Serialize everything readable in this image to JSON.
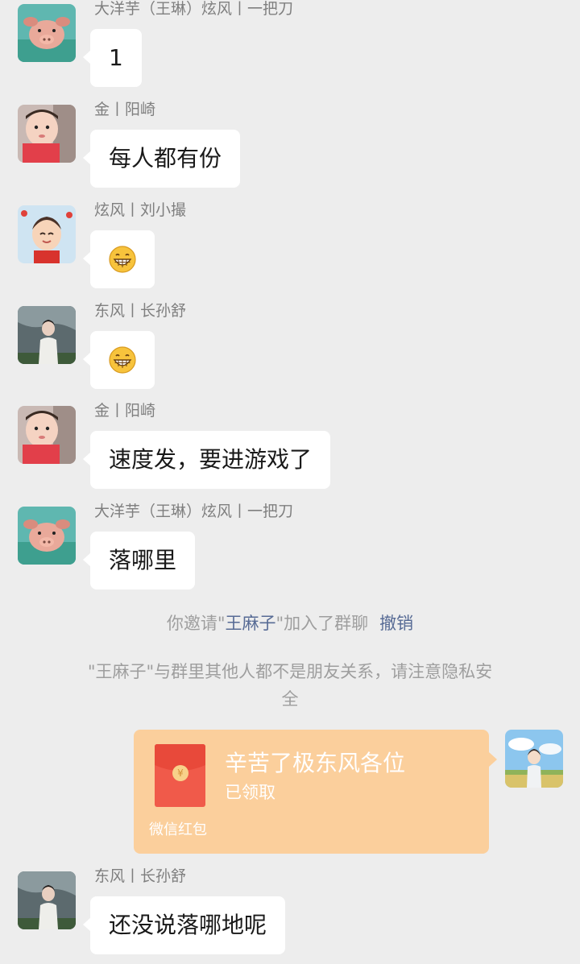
{
  "messages": [
    {
      "sender": "大洋芋（王琳）炫风丨一把刀",
      "text": "1",
      "avatar": "pig-avatar"
    },
    {
      "sender": "金丨阳崎",
      "text": "每人都有份",
      "avatar": "baby-avatar"
    },
    {
      "sender": "炫风丨刘小撮",
      "emoji": "grinning-emoji",
      "avatar": "cartoon-boy-avatar"
    },
    {
      "sender": "东风丨长孙舒",
      "emoji": "grinning-emoji",
      "avatar": "man-portrait-avatar"
    },
    {
      "sender": "金丨阳崎",
      "text": "速度发，要进游戏了",
      "avatar": "baby-avatar"
    },
    {
      "sender": "大洋芋（王琳）炫风丨一把刀",
      "text": "落哪里",
      "avatar": "pig-avatar"
    },
    {
      "sender": "东风丨长孙舒",
      "text": "还没说落哪地呢",
      "avatar": "man-portrait-avatar"
    }
  ],
  "system": {
    "invite_prefix": "你邀请\"",
    "invite_name": "王麻子",
    "invite_suffix": "\"加入了群聊",
    "undo_label": "撤销",
    "warning_line1": "\"王麻子\"与群里其他人都不是朋友关系，请注意隐私安",
    "warning_line2": "全"
  },
  "red_packet": {
    "title": "辛苦了极东风各位",
    "status": "已领取",
    "footer": "微信红包",
    "coin_symbol": "¥",
    "color": "#fbcf9c",
    "envelope_color": "#f05a4a"
  },
  "colors": {
    "background": "#ededed",
    "bubble": "#ffffff",
    "link": "#576b95",
    "sender": "#7f7f7f"
  }
}
